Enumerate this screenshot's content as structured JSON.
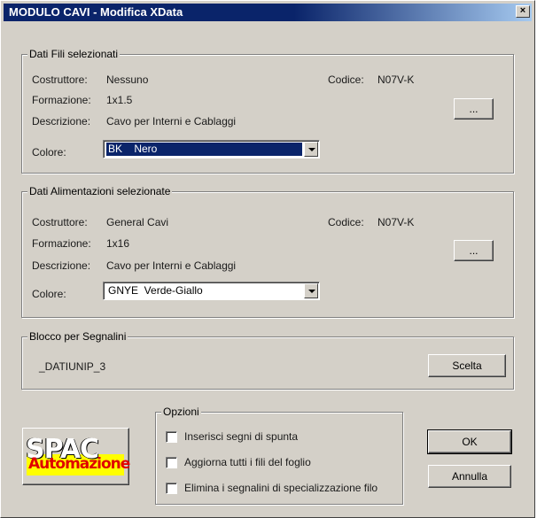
{
  "window": {
    "title": "MODULO CAVI - Modifica XData",
    "close_glyph": "×"
  },
  "fili": {
    "group_title": "Dati Fili selezionati",
    "costruttore_label": "Costruttore:",
    "costruttore_value": "Nessuno",
    "codice_label": "Codice:",
    "codice_value": "N07V-K",
    "formazione_label": "Formazione:",
    "formazione_value": "1x1.5",
    "descrizione_label": "Descrizione:",
    "descrizione_value": "Cavo per Interni e Cablaggi",
    "colore_label": "Colore:",
    "colore_value": "BK    Nero",
    "browse_label": "..."
  },
  "alimentazioni": {
    "group_title": "Dati Alimentazioni selezionate",
    "costruttore_label": "Costruttore:",
    "costruttore_value": "General Cavi",
    "codice_label": "Codice:",
    "codice_value": "N07V-K",
    "formazione_label": "Formazione:",
    "formazione_value": "1x16",
    "descrizione_label": "Descrizione:",
    "descrizione_value": "Cavo per Interni e Cablaggi",
    "colore_label": "Colore:",
    "colore_value": "GNYE  Verde-Giallo",
    "browse_label": "..."
  },
  "segnalini": {
    "group_title": "Blocco per Segnalini",
    "block_name": "_DATIUNIP_3",
    "scelta_label": "Scelta"
  },
  "opzioni": {
    "group_title": "Opzioni",
    "items": [
      {
        "label": "Inserisci segni di spunta",
        "checked": false
      },
      {
        "label": "Aggiorna tutti i fili del foglio",
        "checked": false
      },
      {
        "label": "Elimina i segnalini di specializzazione filo",
        "checked": false
      }
    ]
  },
  "buttons": {
    "ok_label": "OK",
    "annulla_label": "Annulla"
  },
  "logo": {
    "top_text": "SPAC",
    "bottom_text": "Automazione"
  },
  "colors": {
    "titlebar_start": "#0a246a",
    "titlebar_end": "#a6caf0",
    "dialog_bg": "#d4d0c8",
    "selection": "#0a246a",
    "logo_band": "#ffff00",
    "logo_text": "#e00000"
  }
}
